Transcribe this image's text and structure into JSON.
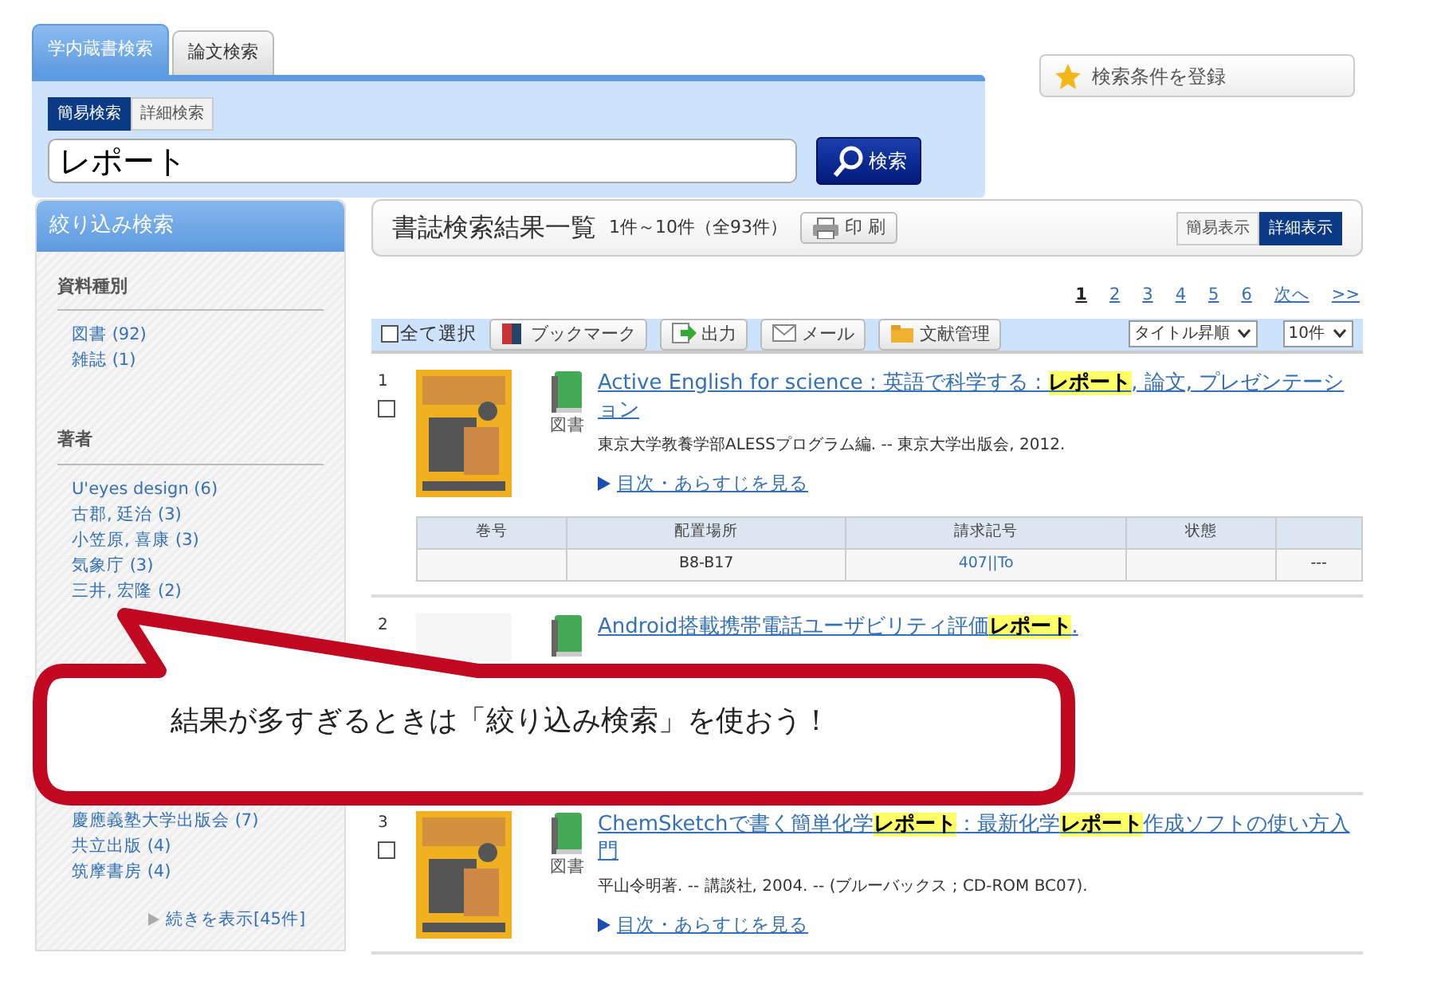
{
  "search_tabs": [
    {
      "label": "学内蔵書検索",
      "selected": true
    },
    {
      "label": "論文検索",
      "selected": false
    }
  ],
  "mode_tabs": [
    {
      "label": "簡易検索",
      "selected": true
    },
    {
      "label": "詳細検索",
      "selected": false
    }
  ],
  "search": {
    "value": "レポート",
    "button": "検索"
  },
  "save_button": "検索条件を登録",
  "sidebar": {
    "title": "絞り込み検索",
    "sections": [
      {
        "heading": "資料種別",
        "items": [
          "図書 (92)",
          "雑誌 (1)"
        ]
      },
      {
        "heading": "著者",
        "items": [
          "U'eyes design (6)",
          "古郡, 廷治 (3)",
          "小笠原, 喜康 (3)",
          "気象庁 (3)",
          "三井, 宏隆 (2)"
        ]
      },
      {
        "items": [
          "慶應義塾大学出版会 (7)",
          "共立出版 (4)",
          "筑摩書房 (4)"
        ],
        "more": "続きを表示[45件]"
      }
    ]
  },
  "results_header": {
    "title": "書誌検索結果一覧",
    "range": "1件～10件（全93件）",
    "print": "印 刷",
    "views": [
      {
        "label": "簡易表示",
        "selected": false
      },
      {
        "label": "詳細表示",
        "selected": true
      }
    ]
  },
  "pagination": [
    {
      "label": "1",
      "selected": true
    },
    {
      "label": "2",
      "selected": false
    },
    {
      "label": "3",
      "selected": false
    },
    {
      "label": "4",
      "selected": false
    },
    {
      "label": "5",
      "selected": false
    },
    {
      "label": "6",
      "selected": false
    },
    {
      "label": "次へ",
      "selected": false
    },
    {
      "label": ">>",
      "selected": false
    }
  ],
  "toolbar": {
    "select_all": "全て選択",
    "checked": false,
    "buttons": [
      "ブックマーク",
      "出力",
      "メール",
      "文献管理"
    ],
    "sort": "タイトル昇順",
    "per_page": "10件"
  },
  "results": [
    {
      "number": "1",
      "checked": false,
      "type": "図書",
      "title": "Active English for science : 英語で科学する : **レポート**, 論文, プレゼンテーション",
      "meta": "東京大学教養学部ALESSプログラム編. -- 東京大学出版会, 2012.",
      "toc": "目次・あらすじを見る",
      "has_cover": true,
      "holdings": {
        "columns": {
          "volume": "巻号",
          "location": "配置場所",
          "call_number": "請求記号",
          "status": "状態"
        },
        "row": {
          "location": "B8-B17",
          "call_number": "407||To",
          "column_5": "---"
        }
      }
    },
    {
      "number": "2",
      "title": "Android搭載携帯電話ユーザビリティ評価**レポート**.",
      "has_cover": false
    },
    {
      "number": "3",
      "checked": false,
      "type": "図書",
      "title": "ChemSketchで書く簡単化学**レポート**：最新化学**レポート**作成ソフトの使い方入門",
      "meta": "平山令明著. -- 講談社, 2004. -- (ブルーバックス ; CD-ROM BC07).",
      "toc": "目次・あらすじを見る",
      "has_cover": true
    }
  ],
  "callout": "結果が多すぎるときは「絞り込み検索」を使おう！"
}
